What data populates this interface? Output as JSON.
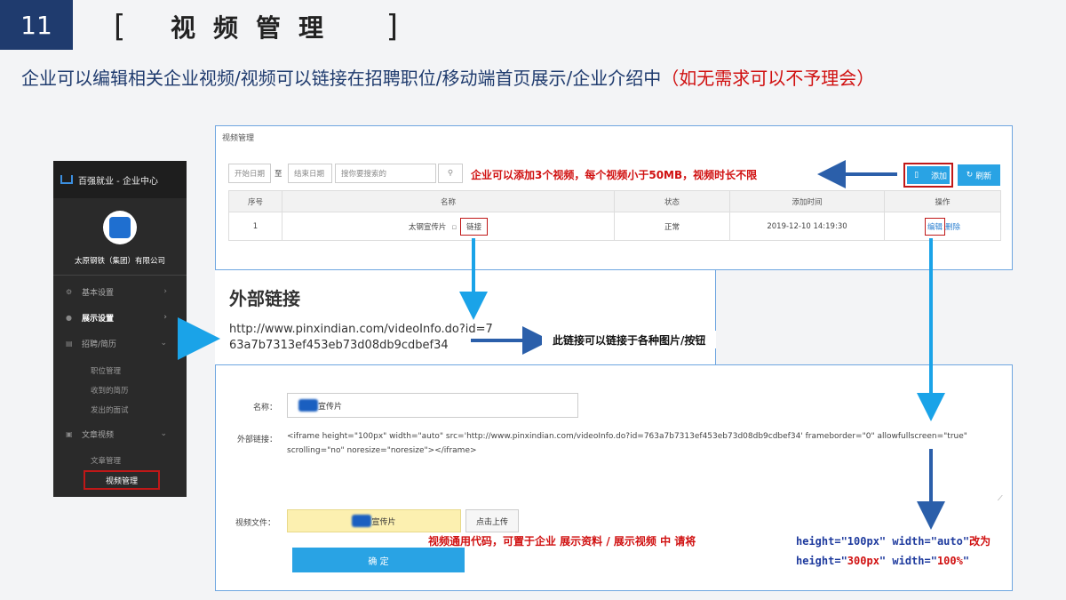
{
  "header": {
    "page_number": "11",
    "title_open": "[",
    "title": "视频管理",
    "title_close": "]"
  },
  "subtitle": {
    "main": "企业可以编辑相关企业视频/视频可以链接在招聘职位/移动端首页展示/企业介绍中",
    "note": "（如无需求可以不予理会）"
  },
  "sidebar": {
    "brand": "百强就业 - 企业中心",
    "company": "太原钢铁（集团）有限公司",
    "items": [
      {
        "label": "基本设置",
        "icon": "gear-icon"
      },
      {
        "label": "展示设置",
        "icon": "info-icon"
      },
      {
        "label": "招聘/简历",
        "icon": "list-icon"
      },
      {
        "label": "文章视频",
        "icon": "doc-icon"
      }
    ],
    "subitems": [
      "职位管理",
      "收到的简历",
      "发出的面试",
      "文章管理",
      "视频管理"
    ]
  },
  "video_panel": {
    "title": "视频管理",
    "start_date": "开始日期",
    "to": "至",
    "end_date": "结束日期",
    "search_placeholder": "搜你要搜索的",
    "add_button": "添加",
    "refresh_button": "刷新",
    "columns": [
      "序号",
      "名称",
      "状态",
      "添加时间",
      "操作"
    ],
    "rows": [
      {
        "index": "1",
        "name": "太钢宣传片",
        "link": "链接",
        "status": "正常",
        "time": "2019-12-10 14:19:30",
        "edit": "编辑",
        "delete": "删除"
      }
    ]
  },
  "external_link": {
    "title": "外部链接",
    "url": "http://www.pinxindian.com/videoInfo.do?id=763a7b7313ef453eb73d08db9cdbef34"
  },
  "form": {
    "name_label": "名称：",
    "name_value": "宣传片",
    "link_label": "外部链接：",
    "code": "<iframe height=\"100px\" width=\"auto\" src='http://www.pinxindian.com/videoInfo.do?id=763a7b7313ef453eb73d08db9cdbef34' frameborder=\"0\" allowfullscreen=\"true\" scrolling=\"no\" noresize=\"noresize\"></iframe>",
    "file_label": "视频文件：",
    "file_value": "宣传片",
    "upload_button": "点击上传",
    "confirm_button": "确 定"
  },
  "annotations": {
    "add_note": "企业可以添加3个视频，每个视频小于50MB，视频时长不限",
    "link_note": "此链接可以链接于各种图片/按钮",
    "code_note": "视频通用代码，可置于企业  展示资料 / 展示视频  中 请将",
    "code_before": "height=\"100px\" width=\"auto\"",
    "code_change": "改为",
    "code_after_h1": "height=\"",
    "code_after_v1": "300px",
    "code_after_h2": "\" width=\"",
    "code_after_v2": "100%",
    "code_after_h3": "\""
  },
  "colors": {
    "accent": "#29a3e4",
    "highlight": "#d01010",
    "arrow": "#1aa3e8",
    "arrow_dark": "#2b5faa",
    "header": "#1f3b6e"
  }
}
